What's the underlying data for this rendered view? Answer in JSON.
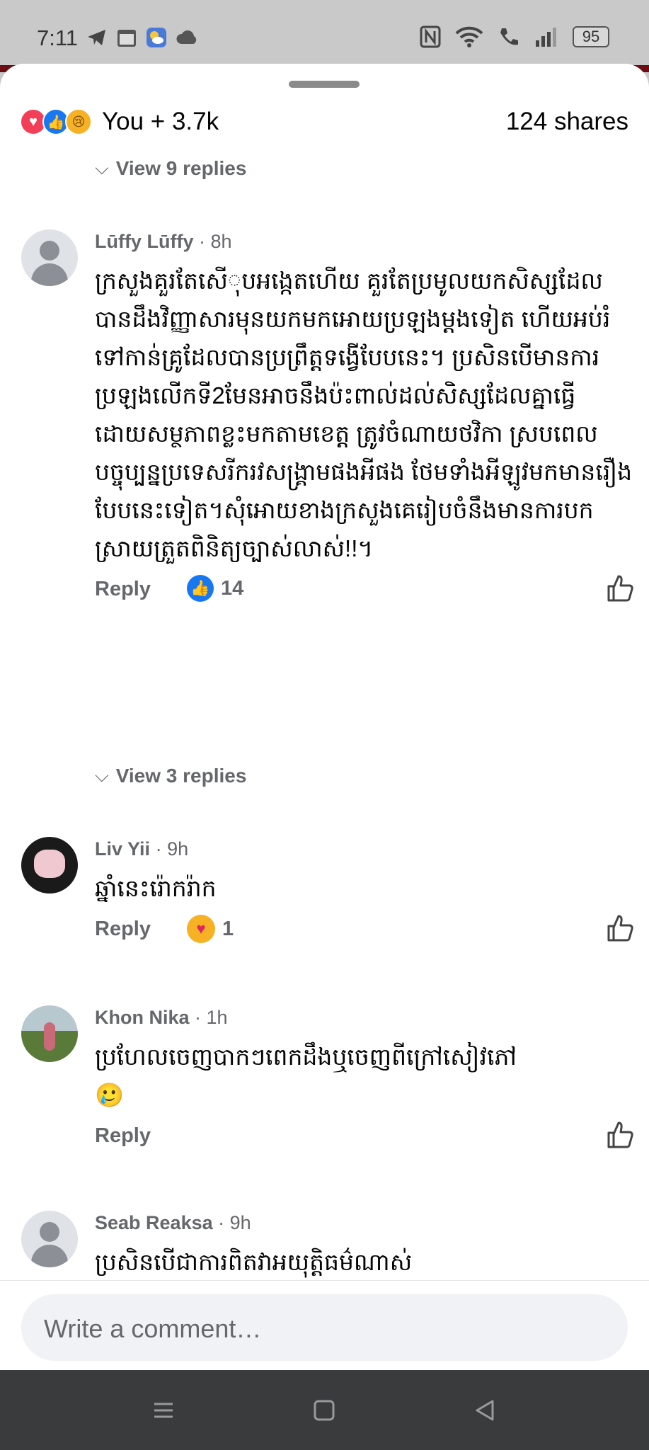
{
  "status_bar": {
    "time": "7:11",
    "battery": "95",
    "icons_left": [
      "telegram-icon",
      "calendar-icon",
      "weather-icon",
      "cloud-icon"
    ],
    "icons_right": [
      "nfc-icon",
      "wifi-icon",
      "volte-call-icon",
      "signal-icon",
      "battery-icon"
    ]
  },
  "post_summary": {
    "reaction_icons": [
      "love-reaction-icon",
      "like-reaction-icon",
      "sad-reaction-icon"
    ],
    "reaction_text": "You + 3.7k",
    "shares_text": "124 shares"
  },
  "top_view_replies": "View 9 replies",
  "comments": [
    {
      "name": "Lūffy Lūffy",
      "time": "8h",
      "avatar": "default-avatar",
      "text": "ក្រសួងគួរតែសើុបអង្កេតហើយ គួរតែប្រមូលយកសិស្សដែលបានដឹងវិញ្ញាសារមុនយកមកអោយប្រឡងម្ដងទៀត ហើយអប់រំទៅកាន់គ្រូដែលបានប្រព្រឹត្តទង្វើបែបនេះ។ ប្រសិនបើមានការប្រឡងលើកទី2មែនអាចនឹងប៉ះពាល់ដល់សិស្សដែលគ្នាធ្វើដោយសម្ថភាពខ្លះមកតាមខេត្ត ត្រូវចំណាយថវិកា ស្របពេលបច្ចុប្បន្នប្រទេសរីករវសង្គ្រាមផងអីផង ថែមទាំងអីឡូវមកមានរឿងបែបនេះទៀត។សុំអោយខាងក្រសួងគេរៀបចំនឹងមានការបកស្រាយត្រួតពិនិត្យច្បាស់លាស់!!។",
      "reply_label": "Reply",
      "reaction_count": "14",
      "reaction_type": "like",
      "view_replies": "View 3 replies"
    },
    {
      "name": "Liv Yii",
      "time": "9h",
      "avatar": "dark-avatar",
      "text": "ឆ្នាំនេះរ៉ោករ៉ាក",
      "reply_label": "Reply",
      "reaction_count": "1",
      "reaction_type": "care"
    },
    {
      "name": "Khon Nika",
      "time": "1h",
      "avatar": "field-avatar",
      "text": "ប្រហែលចេញបាកៗពេកដឹងឬចេញពីក្រៅសៀវភៅ",
      "emoji": "🥲",
      "reply_label": "Reply"
    },
    {
      "name": "Seab Reaksa",
      "time": "9h",
      "avatar": "default-avatar",
      "text": "ប្រសិនបើជាការពិតវាអយុត្តិធម៌ណាស់"
    }
  ],
  "composer": {
    "placeholder": "Write a comment…"
  },
  "nav": [
    "menu-icon",
    "home-icon",
    "back-icon"
  ]
}
